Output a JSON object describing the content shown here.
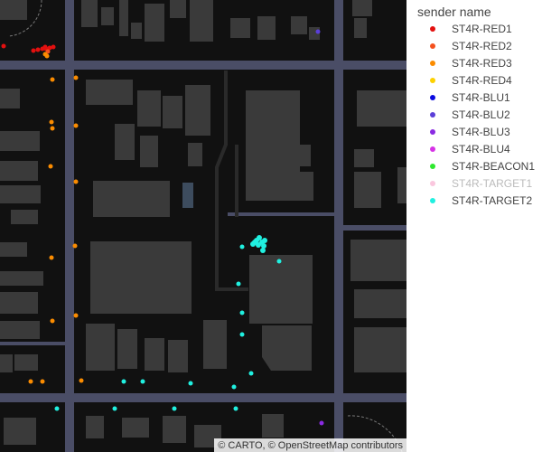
{
  "attribution": "© CARTO, © OpenStreetMap contributors",
  "legend": {
    "title": "sender name",
    "items": [
      {
        "label": "ST4R-RED1",
        "color": "#e3100f"
      },
      {
        "label": "ST4R-RED2",
        "color": "#f4511e"
      },
      {
        "label": "ST4R-RED3",
        "color": "#fb8c00"
      },
      {
        "label": "ST4R-RED4",
        "color": "#fdd100"
      },
      {
        "label": "ST4R-BLU1",
        "color": "#0a0ae0"
      },
      {
        "label": "ST4R-BLU2",
        "color": "#5b3fd8"
      },
      {
        "label": "ST4R-BLU3",
        "color": "#8a2be2"
      },
      {
        "label": "ST4R-BLU4",
        "color": "#d633e6"
      },
      {
        "label": "ST4R-BEACON1",
        "color": "#2ee82e"
      },
      {
        "label": "ST4R-TARGET1",
        "color": "#f7a1c8",
        "dimmed": true
      },
      {
        "label": "ST4R-TARGET2",
        "color": "#20f0e0"
      }
    ]
  }
}
